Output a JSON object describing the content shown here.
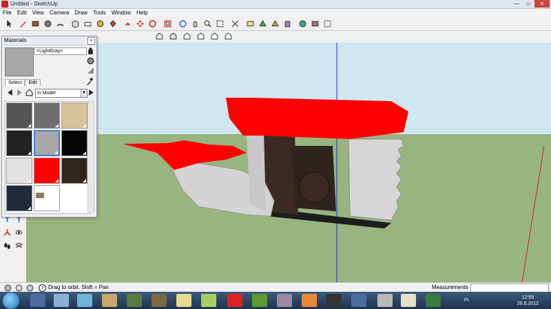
{
  "window": {
    "title": "Untitled - SketchUp"
  },
  "menu": [
    "File",
    "Edit",
    "View",
    "Camera",
    "Draw",
    "Tools",
    "Window",
    "Help"
  ],
  "materials": {
    "panel_title": "Materials",
    "current_name": "<LightGray>",
    "tabs": [
      "Select",
      "Edit"
    ],
    "library": "In Model",
    "swatches": [
      {
        "color": "#555555",
        "name": "dark-gray-swatch"
      },
      {
        "color": "#6e6e6e",
        "name": "gray-swatch"
      },
      {
        "color": "#d8c49a",
        "name": "tan-swatch"
      },
      {
        "color": "#222222",
        "name": "charcoal-swatch"
      },
      {
        "color": "#a8a8a8",
        "name": "light-gray-swatch",
        "selected": true
      },
      {
        "color": "#050505",
        "name": "black-swatch"
      },
      {
        "color": "#e2e2e2",
        "name": "white-swatch"
      },
      {
        "color": "#ff0000",
        "name": "red-swatch"
      },
      {
        "color": "#2f2620",
        "name": "dark-brown-swatch"
      },
      {
        "color": "#1f2a3c",
        "name": "navy-swatch"
      },
      {
        "color": "#ffffff",
        "name": "texture-swatch"
      }
    ]
  },
  "status": {
    "text": "Drag to orbit.  Shift = Pan",
    "measurements_label": "Measurements",
    "measurements_value": ""
  },
  "clock": {
    "time": "12:55",
    "date": "26.8.2012",
    "lang": "FI"
  },
  "colors": {
    "sky": "#cfe7f0",
    "ground": "#98b47f",
    "model_red": "#ff0000",
    "model_gray": "#d4d4d4",
    "axis_blue": "#1a2fd8",
    "axis_red": "#cc2222"
  }
}
